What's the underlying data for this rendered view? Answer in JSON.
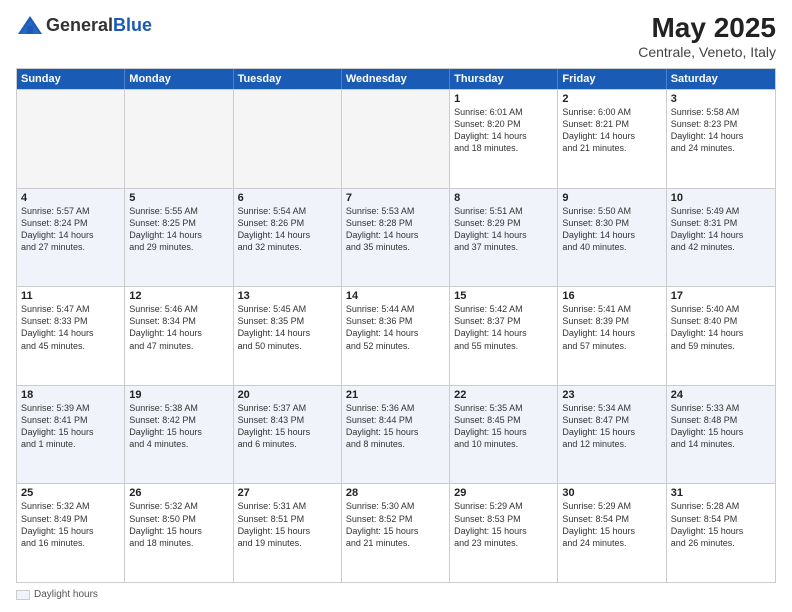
{
  "header": {
    "logo_line1": "General",
    "logo_line2": "Blue",
    "month": "May 2025",
    "location": "Centrale, Veneto, Italy"
  },
  "weekdays": [
    "Sunday",
    "Monday",
    "Tuesday",
    "Wednesday",
    "Thursday",
    "Friday",
    "Saturday"
  ],
  "rows": [
    [
      {
        "day": "",
        "text": "",
        "empty": true
      },
      {
        "day": "",
        "text": "",
        "empty": true
      },
      {
        "day": "",
        "text": "",
        "empty": true
      },
      {
        "day": "",
        "text": "",
        "empty": true
      },
      {
        "day": "1",
        "text": "Sunrise: 6:01 AM\nSunset: 8:20 PM\nDaylight: 14 hours\nand 18 minutes."
      },
      {
        "day": "2",
        "text": "Sunrise: 6:00 AM\nSunset: 8:21 PM\nDaylight: 14 hours\nand 21 minutes."
      },
      {
        "day": "3",
        "text": "Sunrise: 5:58 AM\nSunset: 8:23 PM\nDaylight: 14 hours\nand 24 minutes."
      }
    ],
    [
      {
        "day": "4",
        "text": "Sunrise: 5:57 AM\nSunset: 8:24 PM\nDaylight: 14 hours\nand 27 minutes."
      },
      {
        "day": "5",
        "text": "Sunrise: 5:55 AM\nSunset: 8:25 PM\nDaylight: 14 hours\nand 29 minutes."
      },
      {
        "day": "6",
        "text": "Sunrise: 5:54 AM\nSunset: 8:26 PM\nDaylight: 14 hours\nand 32 minutes."
      },
      {
        "day": "7",
        "text": "Sunrise: 5:53 AM\nSunset: 8:28 PM\nDaylight: 14 hours\nand 35 minutes."
      },
      {
        "day": "8",
        "text": "Sunrise: 5:51 AM\nSunset: 8:29 PM\nDaylight: 14 hours\nand 37 minutes."
      },
      {
        "day": "9",
        "text": "Sunrise: 5:50 AM\nSunset: 8:30 PM\nDaylight: 14 hours\nand 40 minutes."
      },
      {
        "day": "10",
        "text": "Sunrise: 5:49 AM\nSunset: 8:31 PM\nDaylight: 14 hours\nand 42 minutes."
      }
    ],
    [
      {
        "day": "11",
        "text": "Sunrise: 5:47 AM\nSunset: 8:33 PM\nDaylight: 14 hours\nand 45 minutes."
      },
      {
        "day": "12",
        "text": "Sunrise: 5:46 AM\nSunset: 8:34 PM\nDaylight: 14 hours\nand 47 minutes."
      },
      {
        "day": "13",
        "text": "Sunrise: 5:45 AM\nSunset: 8:35 PM\nDaylight: 14 hours\nand 50 minutes."
      },
      {
        "day": "14",
        "text": "Sunrise: 5:44 AM\nSunset: 8:36 PM\nDaylight: 14 hours\nand 52 minutes."
      },
      {
        "day": "15",
        "text": "Sunrise: 5:42 AM\nSunset: 8:37 PM\nDaylight: 14 hours\nand 55 minutes."
      },
      {
        "day": "16",
        "text": "Sunrise: 5:41 AM\nSunset: 8:39 PM\nDaylight: 14 hours\nand 57 minutes."
      },
      {
        "day": "17",
        "text": "Sunrise: 5:40 AM\nSunset: 8:40 PM\nDaylight: 14 hours\nand 59 minutes."
      }
    ],
    [
      {
        "day": "18",
        "text": "Sunrise: 5:39 AM\nSunset: 8:41 PM\nDaylight: 15 hours\nand 1 minute."
      },
      {
        "day": "19",
        "text": "Sunrise: 5:38 AM\nSunset: 8:42 PM\nDaylight: 15 hours\nand 4 minutes."
      },
      {
        "day": "20",
        "text": "Sunrise: 5:37 AM\nSunset: 8:43 PM\nDaylight: 15 hours\nand 6 minutes."
      },
      {
        "day": "21",
        "text": "Sunrise: 5:36 AM\nSunset: 8:44 PM\nDaylight: 15 hours\nand 8 minutes."
      },
      {
        "day": "22",
        "text": "Sunrise: 5:35 AM\nSunset: 8:45 PM\nDaylight: 15 hours\nand 10 minutes."
      },
      {
        "day": "23",
        "text": "Sunrise: 5:34 AM\nSunset: 8:47 PM\nDaylight: 15 hours\nand 12 minutes."
      },
      {
        "day": "24",
        "text": "Sunrise: 5:33 AM\nSunset: 8:48 PM\nDaylight: 15 hours\nand 14 minutes."
      }
    ],
    [
      {
        "day": "25",
        "text": "Sunrise: 5:32 AM\nSunset: 8:49 PM\nDaylight: 15 hours\nand 16 minutes."
      },
      {
        "day": "26",
        "text": "Sunrise: 5:32 AM\nSunset: 8:50 PM\nDaylight: 15 hours\nand 18 minutes."
      },
      {
        "day": "27",
        "text": "Sunrise: 5:31 AM\nSunset: 8:51 PM\nDaylight: 15 hours\nand 19 minutes."
      },
      {
        "day": "28",
        "text": "Sunrise: 5:30 AM\nSunset: 8:52 PM\nDaylight: 15 hours\nand 21 minutes."
      },
      {
        "day": "29",
        "text": "Sunrise: 5:29 AM\nSunset: 8:53 PM\nDaylight: 15 hours\nand 23 minutes."
      },
      {
        "day": "30",
        "text": "Sunrise: 5:29 AM\nSunset: 8:54 PM\nDaylight: 15 hours\nand 24 minutes."
      },
      {
        "day": "31",
        "text": "Sunrise: 5:28 AM\nSunset: 8:54 PM\nDaylight: 15 hours\nand 26 minutes."
      }
    ]
  ],
  "footer": {
    "legend_label": "Daylight hours"
  }
}
